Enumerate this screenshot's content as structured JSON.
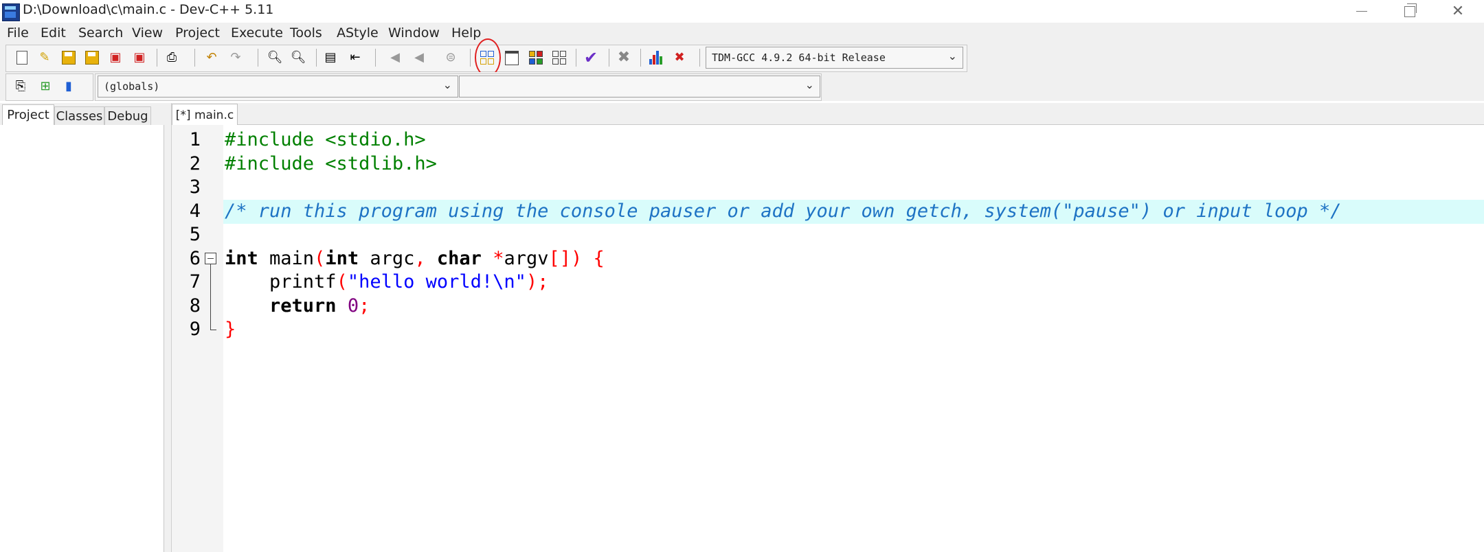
{
  "window": {
    "title": "D:\\Download\\c\\main.c - Dev-C++ 5.11"
  },
  "menu": [
    "File",
    "Edit",
    "Search",
    "View",
    "Project",
    "Execute",
    "Tools",
    "AStyle",
    "Window",
    "Help"
  ],
  "toolbar": {
    "compiler_select": "TDM-GCC 4.9.2 64-bit Release",
    "scope_select": "(globals)",
    "function_select": ""
  },
  "panel_tabs": [
    "Project",
    "Classes",
    "Debug"
  ],
  "editor_tab": "[*] main.c",
  "line_numbers": [
    "1",
    "2",
    "3",
    "4",
    "5",
    "6",
    "7",
    "8",
    "9"
  ],
  "code": {
    "l1": "#include <stdio.h>",
    "l2": "#include <stdlib.h>",
    "l4": "/* run this program using the console pauser or add your own getch, system(\"pause\") or input loop */",
    "l6": {
      "t1": "int",
      "t2": " main",
      "t3": "(",
      "t4": "int",
      "t5": " argc",
      "t6": ",",
      "t7": " char",
      "t8": " *",
      "t9": "argv",
      "t10": "[])",
      "t11": " {"
    },
    "l7": {
      "t1": "    printf",
      "t2": "(",
      "t3": "\"hello world!\\n\"",
      "t4": ");"
    },
    "l8": {
      "t1": "    return",
      "t2": " 0",
      "t3": ";"
    },
    "l9": "}"
  },
  "colors": {
    "preprocessor": "#008000",
    "comment": "#1e73c4",
    "symbol": "#ff0000",
    "string": "#0000ff",
    "number": "#800080",
    "current_line": "#d9fcfb"
  }
}
